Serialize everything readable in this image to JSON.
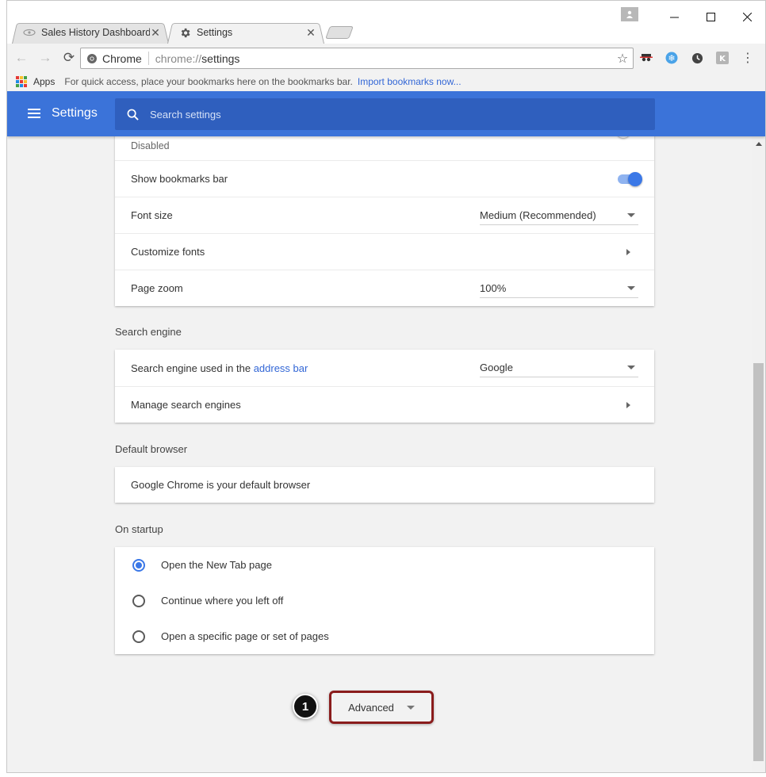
{
  "tabs": [
    {
      "title": "Sales History Dashboard",
      "icon": "dashboard-favicon",
      "active": false
    },
    {
      "title": "Settings",
      "icon": "gear-icon",
      "active": true
    }
  ],
  "omnibox": {
    "site_label": "Chrome",
    "url_scheme": "chrome://",
    "url_path": "settings"
  },
  "bookmarks": {
    "apps_label": "Apps",
    "hint": "For quick access, place your bookmarks here on the bookmarks bar.",
    "import_link": "Import bookmarks now..."
  },
  "header": {
    "title": "Settings",
    "search_placeholder": "Search settings"
  },
  "appearance": {
    "partial_label": "Disabled",
    "show_bookmarks_label": "Show bookmarks bar",
    "show_bookmarks_on": true,
    "font_size_label": "Font size",
    "font_size_value": "Medium (Recommended)",
    "customize_fonts_label": "Customize fonts",
    "page_zoom_label": "Page zoom",
    "page_zoom_value": "100%"
  },
  "search_engine": {
    "section_title": "Search engine",
    "used_label_prefix": "Search engine used in the",
    "used_label_link": "address bar",
    "engine_value": "Google",
    "manage_label": "Manage search engines"
  },
  "default_browser": {
    "section_title": "Default browser",
    "status": "Google Chrome is your default browser"
  },
  "startup": {
    "section_title": "On startup",
    "options": [
      {
        "label": "Open the New Tab page",
        "checked": true
      },
      {
        "label": "Continue where you left off",
        "checked": false
      },
      {
        "label": "Open a specific page or set of pages",
        "checked": false
      }
    ]
  },
  "advanced": {
    "label": "Advanced",
    "step_number": "1"
  }
}
